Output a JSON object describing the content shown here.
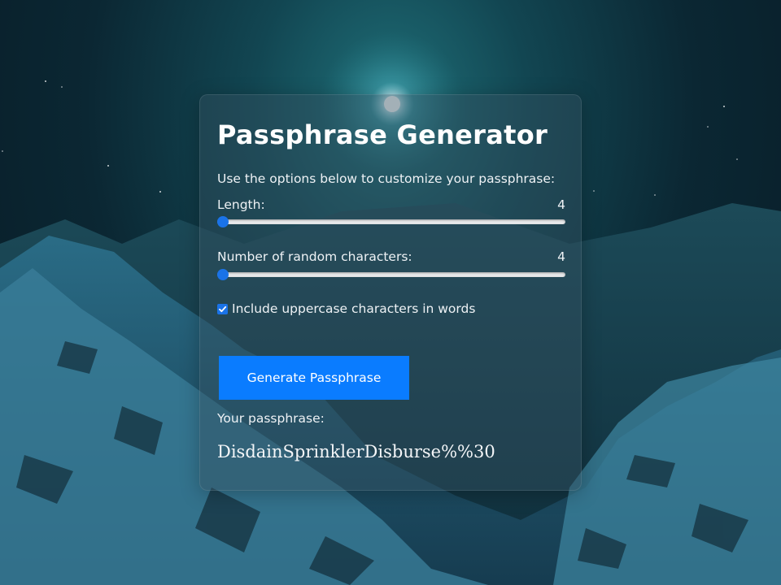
{
  "app": {
    "title": "Passphrase Generator",
    "instructions": "Use the options below to customize your passphrase:"
  },
  "length": {
    "label": "Length:",
    "value": "4",
    "slider_fraction": 0.0
  },
  "random_chars": {
    "label": "Number of random characters:",
    "value": "4",
    "slider_fraction": 0.0
  },
  "uppercase": {
    "label": "Include uppercase characters in words",
    "checked": true
  },
  "generate_button": {
    "label": "Generate Passphrase"
  },
  "result": {
    "label": "Your passphrase:",
    "value": "DisdainSprinklerDisburse%%30"
  },
  "colors": {
    "accent": "#0a7cff",
    "slider_thumb": "#1a73e8",
    "checkbox": "#1a73e8"
  }
}
